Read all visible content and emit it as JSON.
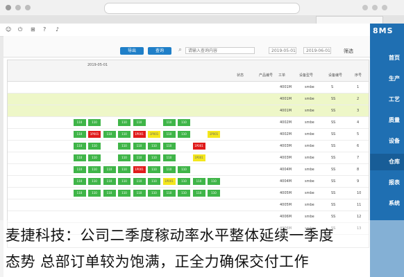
{
  "browser": {
    "url": "",
    "tab_title": "",
    "buttons": [
      "⟲",
      "☐",
      "✕"
    ]
  },
  "appbar": {
    "title": "",
    "icons": [
      "gear-icon",
      "bell-icon",
      "grid-icon",
      "help-icon",
      "user-icon"
    ],
    "user_label": ""
  },
  "sidebar": {
    "logo": "8MS",
    "items": [
      {
        "label": "首页",
        "active": false
      },
      {
        "label": "生产",
        "active": false
      },
      {
        "label": "工艺",
        "active": false
      },
      {
        "label": "质量",
        "active": false
      },
      {
        "label": "设备",
        "active": false
      },
      {
        "label": "仓库",
        "active": true
      },
      {
        "label": "报表",
        "active": false
      },
      {
        "label": "系统",
        "active": false
      }
    ]
  },
  "toolbar": {
    "btn1": "导出",
    "btn2": "查询",
    "search_placeholder": "请输入查询内容",
    "date_from": "2019-05-01",
    "date_to": "2019-06-01",
    "label_left": "筛选"
  },
  "grid": {
    "columns": [
      "序号",
      "设备编号",
      "设备型号",
      "工单",
      "产品编号",
      "状态"
    ],
    "rows": [
      {
        "no": "1",
        "code": "S",
        "model": "smbe",
        "wo": "4001M",
        "prod": "",
        "hl": false
      },
      {
        "no": "2",
        "code": "SS",
        "model": "smbe",
        "wo": "4001M",
        "prod": "",
        "hl": true
      },
      {
        "no": "3",
        "code": "SS",
        "model": "smbe",
        "wo": "4001M",
        "prod": "",
        "hl": true
      },
      {
        "no": "4",
        "code": "SS",
        "model": "smbe",
        "wo": "4002M",
        "prod": "",
        "hl": false
      },
      {
        "no": "5",
        "code": "SS",
        "model": "smbe",
        "wo": "4002M",
        "prod": "",
        "hl": false
      },
      {
        "no": "6",
        "code": "SS",
        "model": "smbe",
        "wo": "4003M",
        "prod": "",
        "hl": false
      },
      {
        "no": "7",
        "code": "SS",
        "model": "smbe",
        "wo": "4003M",
        "prod": "",
        "hl": false
      },
      {
        "no": "8",
        "code": "SS",
        "model": "smbe",
        "wo": "4004M",
        "prod": "",
        "hl": false
      },
      {
        "no": "9",
        "code": "SS",
        "model": "smbe",
        "wo": "4004M",
        "prod": "",
        "hl": false
      },
      {
        "no": "10",
        "code": "SS",
        "model": "smbe",
        "wo": "4005M",
        "prod": "",
        "hl": false
      },
      {
        "no": "11",
        "code": "SS",
        "model": "smbe",
        "wo": "4005M",
        "prod": "",
        "hl": false
      },
      {
        "no": "12",
        "code": "SS",
        "model": "smbe",
        "wo": "4006M",
        "prod": "",
        "hl": false
      },
      {
        "no": "13",
        "code": "SS",
        "model": "smbe",
        "wo": "4006M",
        "prod": "",
        "hl": false
      }
    ],
    "status_cells": [
      {
        "row": 3,
        "col": 2,
        "status": "green",
        "text": "110"
      },
      {
        "row": 3,
        "col": 3,
        "status": "green",
        "text": "110"
      },
      {
        "row": 3,
        "col": 5,
        "status": "green",
        "text": "110"
      },
      {
        "row": 3,
        "col": 6,
        "status": "green",
        "text": "110"
      },
      {
        "row": 3,
        "col": 8,
        "status": "green",
        "text": "110"
      },
      {
        "row": 3,
        "col": 9,
        "status": "green",
        "text": "110"
      },
      {
        "row": 4,
        "col": 0,
        "status": "yellow",
        "text": "1P001"
      },
      {
        "row": 4,
        "col": 2,
        "status": "green",
        "text": "110"
      },
      {
        "row": 4,
        "col": 3,
        "status": "green",
        "text": "110"
      },
      {
        "row": 4,
        "col": 4,
        "status": "yellow",
        "text": "1P001"
      },
      {
        "row": 4,
        "col": 5,
        "status": "red",
        "text": "1P001"
      },
      {
        "row": 4,
        "col": 6,
        "status": "green",
        "text": "110"
      },
      {
        "row": 4,
        "col": 7,
        "status": "green",
        "text": "110"
      },
      {
        "row": 4,
        "col": 8,
        "status": "red",
        "text": "1P001"
      },
      {
        "row": 4,
        "col": 9,
        "status": "green",
        "text": "110"
      },
      {
        "row": 5,
        "col": 1,
        "status": "red",
        "text": "1P001"
      },
      {
        "row": 5,
        "col": 3,
        "status": "green",
        "text": "110"
      },
      {
        "row": 5,
        "col": 4,
        "status": "green",
        "text": "110"
      },
      {
        "row": 5,
        "col": 5,
        "status": "green",
        "text": "110"
      },
      {
        "row": 5,
        "col": 6,
        "status": "green",
        "text": "110"
      },
      {
        "row": 5,
        "col": 8,
        "status": "green",
        "text": "110"
      },
      {
        "row": 5,
        "col": 9,
        "status": "green",
        "text": "110"
      },
      {
        "row": 6,
        "col": 1,
        "status": "yellow",
        "text": "1P001"
      },
      {
        "row": 6,
        "col": 3,
        "status": "green",
        "text": "110"
      },
      {
        "row": 6,
        "col": 4,
        "status": "green",
        "text": "110"
      },
      {
        "row": 6,
        "col": 5,
        "status": "green",
        "text": "110"
      },
      {
        "row": 6,
        "col": 6,
        "status": "green",
        "text": "110"
      },
      {
        "row": 6,
        "col": 8,
        "status": "green",
        "text": "110"
      },
      {
        "row": 6,
        "col": 9,
        "status": "green",
        "text": "110"
      },
      {
        "row": 7,
        "col": 2,
        "status": "green",
        "text": "110"
      },
      {
        "row": 7,
        "col": 3,
        "status": "green",
        "text": "110"
      },
      {
        "row": 7,
        "col": 4,
        "status": "green",
        "text": "110"
      },
      {
        "row": 7,
        "col": 5,
        "status": "red",
        "text": "1P001"
      },
      {
        "row": 7,
        "col": 6,
        "status": "green",
        "text": "110"
      },
      {
        "row": 7,
        "col": 7,
        "status": "green",
        "text": "110"
      },
      {
        "row": 7,
        "col": 8,
        "status": "green",
        "text": "110"
      },
      {
        "row": 7,
        "col": 9,
        "status": "green",
        "text": "110"
      },
      {
        "row": 8,
        "col": 0,
        "status": "green",
        "text": "110"
      },
      {
        "row": 8,
        "col": 1,
        "status": "green",
        "text": "110"
      },
      {
        "row": 8,
        "col": 2,
        "status": "green",
        "text": "110"
      },
      {
        "row": 8,
        "col": 3,
        "status": "yellow",
        "text": "1P001"
      },
      {
        "row": 8,
        "col": 4,
        "status": "green",
        "text": "110"
      },
      {
        "row": 8,
        "col": 5,
        "status": "green",
        "text": "110"
      },
      {
        "row": 8,
        "col": 6,
        "status": "green",
        "text": "110"
      },
      {
        "row": 8,
        "col": 7,
        "status": "green",
        "text": "110"
      },
      {
        "row": 8,
        "col": 8,
        "status": "green",
        "text": "110"
      },
      {
        "row": 8,
        "col": 9,
        "status": "green",
        "text": "110"
      },
      {
        "row": 9,
        "col": 0,
        "status": "green",
        "text": "110"
      },
      {
        "row": 9,
        "col": 1,
        "status": "green",
        "text": "110"
      },
      {
        "row": 9,
        "col": 2,
        "status": "green",
        "text": "110"
      },
      {
        "row": 9,
        "col": 3,
        "status": "green",
        "text": "110"
      },
      {
        "row": 9,
        "col": 4,
        "status": "green",
        "text": "110"
      },
      {
        "row": 9,
        "col": 5,
        "status": "green",
        "text": "110"
      },
      {
        "row": 9,
        "col": 6,
        "status": "green",
        "text": "110"
      },
      {
        "row": 9,
        "col": 7,
        "status": "green",
        "text": "110"
      },
      {
        "row": 9,
        "col": 8,
        "status": "green",
        "text": "110"
      },
      {
        "row": 9,
        "col": 9,
        "status": "green",
        "text": "110"
      }
    ]
  },
  "caption": {
    "line1": "麦捷科技：公司二季度稼动率水平整体延续一季度",
    "line2": "态势 总部订单较为饱满，正全力确保交付工作"
  },
  "colors": {
    "green": "#3fb548",
    "yellow": "#f4e71c",
    "red": "#e01b1b",
    "sidebar": "#1f6fb2"
  }
}
